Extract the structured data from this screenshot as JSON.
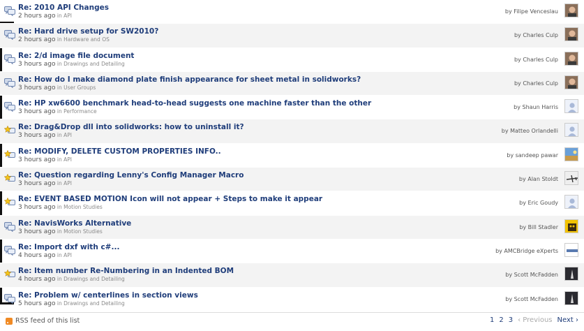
{
  "threads": [
    {
      "title": "Re: 2010 API Changes",
      "ago": "2 hours ago",
      "in": "in",
      "forum": "API",
      "by": "by",
      "author": "Filipe Venceslau",
      "icon": "speech-bubbles-icon",
      "avatar": "photo"
    },
    {
      "title": "Re: Hard drive setup for SW2010?",
      "ago": "2 hours ago",
      "in": "in",
      "forum": "Hardware and OS",
      "by": "by",
      "author": "Charles Culp",
      "icon": "speech-bubbles-icon",
      "avatar": "photo"
    },
    {
      "title": "Re: 2/d image file document",
      "ago": "3 hours ago",
      "in": "in",
      "forum": "Drawings and Detailing",
      "by": "by",
      "author": "Charles Culp",
      "icon": "speech-bubbles-icon",
      "avatar": "photo"
    },
    {
      "title": "Re: How do I make diamond plate finish appearance for sheet metal in solidworks?",
      "ago": "3 hours ago",
      "in": "in",
      "forum": "User Groups",
      "by": "by",
      "author": "Charles Culp",
      "icon": "speech-bubbles-icon",
      "avatar": "photo"
    },
    {
      "title": "Re: HP xw6600 benchmark head-to-head suggests one machine faster than the other",
      "ago": "3 hours ago",
      "in": "in",
      "forum": "Performance",
      "by": "by",
      "author": "Shaun Harris",
      "icon": "speech-bubbles-icon",
      "avatar": "default"
    },
    {
      "title": "Re: Drag&Drop dll into solidworks: how to uninstall it?",
      "ago": "3 hours ago",
      "in": "in",
      "forum": "API",
      "by": "by",
      "author": "Matteo Orlandelli",
      "icon": "star-bubble-icon",
      "avatar": "default"
    },
    {
      "title": "Re: MODIFY, DELETE CUSTOM PROPERTIES INFO..",
      "ago": "3 hours ago",
      "in": "in",
      "forum": "API",
      "by": "by",
      "author": "sandeep pawar",
      "icon": "star-bubble-icon",
      "avatar": "landscape"
    },
    {
      "title": "Re: Question regarding Lenny's Config Manager Macro",
      "ago": "3 hours ago",
      "in": "in",
      "forum": "API",
      "by": "by",
      "author": "Alan Stoldt",
      "icon": "star-bubble-icon",
      "avatar": "plane"
    },
    {
      "title": "Re: EVENT BASED MOTION Icon will not appear + Steps to make it appear",
      "ago": "3 hours ago",
      "in": "in",
      "forum": "Motion Studies",
      "by": "by",
      "author": "Eric Goudy",
      "icon": "star-bubble-icon",
      "avatar": "default"
    },
    {
      "title": "Re: NavisWorks Alternative",
      "ago": "3 hours ago",
      "in": "in",
      "forum": "Motion Studies",
      "by": "by",
      "author": "Bill Stadler",
      "icon": "speech-bubbles-icon",
      "avatar": "yellow"
    },
    {
      "title": "Re: Import dxf with c#...",
      "ago": "4 hours ago",
      "in": "in",
      "forum": "API",
      "by": "by",
      "author": "AMCBridge eXperts",
      "icon": "speech-bubbles-icon",
      "avatar": "logo"
    },
    {
      "title": "Re: Item number Re-Numbering in an Indented BOM",
      "ago": "4 hours ago",
      "in": "in",
      "forum": "Drawings and Detailing",
      "by": "by",
      "author": "Scott McFadden",
      "icon": "star-bubble-icon",
      "avatar": "dark"
    },
    {
      "title": "Re: Problem w/ centerlines in section views",
      "ago": "5 hours ago",
      "in": "in",
      "forum": "Drawings and Detailing",
      "by": "by",
      "author": "Scott McFadden",
      "icon": "speech-bubbles-icon",
      "avatar": "dark"
    }
  ],
  "footer": {
    "rss_label": "RSS feed of this list",
    "pages": [
      "1",
      "2",
      "3"
    ],
    "prev_label": "‹ Previous",
    "next_label": "Next ›"
  },
  "colors": {
    "title": "#1f3d7a",
    "alt_row": "#f3f3f3",
    "rss": "#f08a24"
  }
}
